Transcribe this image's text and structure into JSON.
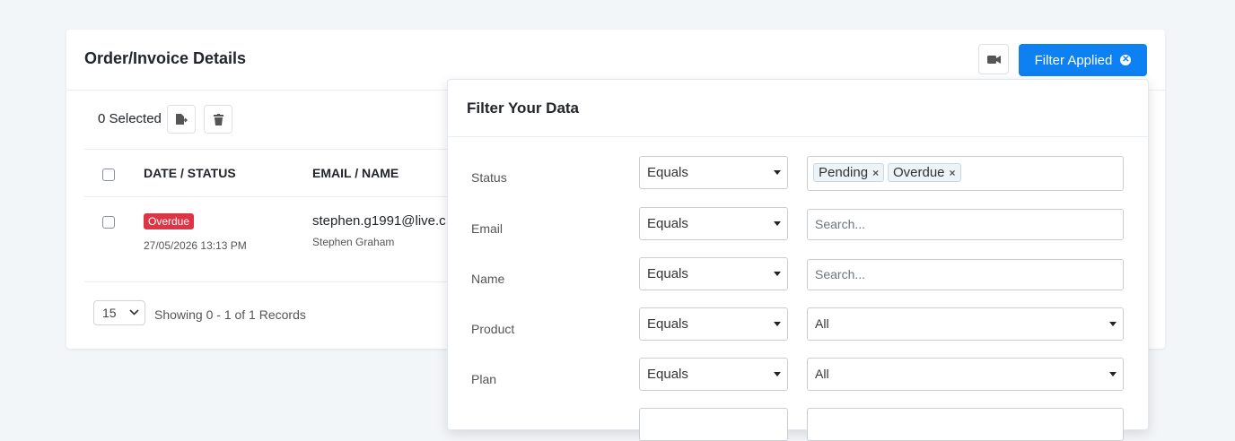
{
  "card": {
    "title": "Order/Invoice Details",
    "filter_button_label": "Filter Applied",
    "selected_label": "0 Selected"
  },
  "table": {
    "headers": [
      "DATE / STATUS",
      "EMAIL / NAME"
    ],
    "rows": [
      {
        "status": "Overdue",
        "date": "27/05/2026 13:13 PM",
        "email": "stephen.g1991@live.c",
        "name": "Stephen Graham"
      }
    ]
  },
  "footer": {
    "per_page": "15",
    "records_text": "Showing 0 - 1 of 1 Records"
  },
  "filter_panel": {
    "title": "Filter Your Data",
    "rows": [
      {
        "label": "Status",
        "operator": "Equals",
        "tags": [
          "Pending",
          "Overdue"
        ]
      },
      {
        "label": "Email",
        "operator": "Equals",
        "placeholder": "Search..."
      },
      {
        "label": "Name",
        "operator": "Equals",
        "placeholder": "Search..."
      },
      {
        "label": "Product",
        "operator": "Equals",
        "value": "All"
      },
      {
        "label": "Plan",
        "operator": "Equals",
        "value": "All"
      }
    ]
  },
  "colors": {
    "primary": "#0d80f2",
    "overdue_badge": "#dc3545",
    "background": "#f3f6f9"
  },
  "icons": [
    "video-camera-icon",
    "close-circle-icon",
    "export-icon",
    "trash-icon",
    "chevron-down-icon",
    "caret-down-icon",
    "tag-remove-icon"
  ]
}
